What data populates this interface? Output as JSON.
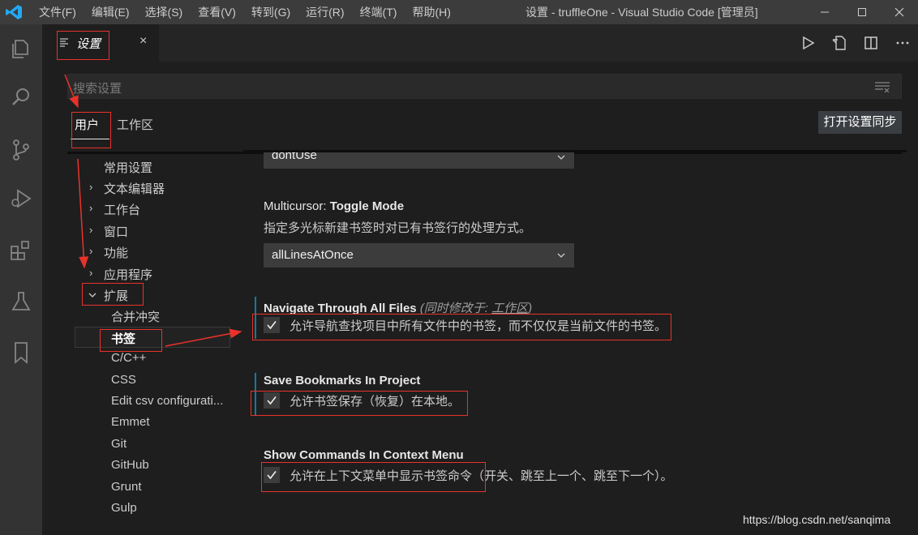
{
  "titlebar": {
    "menus": [
      "文件(F)",
      "编辑(E)",
      "选择(S)",
      "查看(V)",
      "转到(G)",
      "运行(R)",
      "终端(T)",
      "帮助(H)"
    ],
    "title": "设置 - truffleOne - Visual Studio Code [管理员]",
    "minimize": "—",
    "maximize": "☐",
    "close": "✕"
  },
  "activity_icons": [
    "explorer-icon",
    "search-icon",
    "source-control-icon",
    "run-debug-icon",
    "extensions-icon",
    "testing-icon",
    "bookmarks-icon"
  ],
  "tab": {
    "label": "设置",
    "close": "×"
  },
  "search": {
    "placeholder": "搜索设置"
  },
  "scope": {
    "user": "用户",
    "workspace": "工作区",
    "sync_button": "打开设置同步"
  },
  "toc": {
    "common": "常用设置",
    "text_editor": "文本编辑器",
    "workbench": "工作台",
    "window": "窗口",
    "features": "功能",
    "application": "应用程序",
    "extensions": "扩展",
    "ext_items": [
      "合并冲突",
      "书签",
      "C/C++",
      "CSS",
      "Edit csv configurati...",
      "Emmet",
      "Git",
      "GitHub",
      "Grunt",
      "Gulp"
    ]
  },
  "settings": {
    "prev_dropdown_value": "dontUse",
    "multicursor": {
      "category": "Multicursor: ",
      "name": "Toggle Mode",
      "description": "指定多光标新建书签时对已有书签行的处理方式。",
      "value": "allLinesAtOnce"
    },
    "navigate": {
      "name": "Navigate Through All Files",
      "hint_prefix": "(同时修改于: ",
      "hint_link": "工作区",
      "hint_suffix": ")",
      "label": "允许导航查找项目中所有文件中的书签，而不仅仅是当前文件的书签。",
      "checked": true
    },
    "save_bookmarks": {
      "name": "Save Bookmarks In Project",
      "label": "允许书签保存（恢复）在本地。",
      "checked": true
    },
    "show_commands": {
      "name": "Show Commands In Context Menu",
      "label": "允许在上下文菜单中显示书签命令（开关、跳至上一个、跳至下一个）。",
      "checked": true
    }
  },
  "watermark": "https://blog.csdn.net/sanqima",
  "colors": {
    "annotation_red": "#e8322b",
    "accent_blue": "#007acc",
    "modified_indicator": "#0c7d9d"
  }
}
